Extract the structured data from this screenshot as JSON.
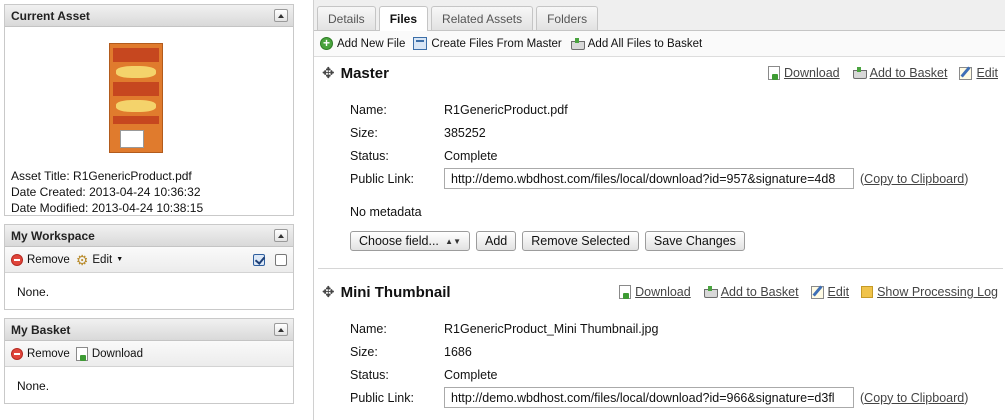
{
  "current_asset": {
    "title": "Current Asset",
    "asset_title_label": "Asset Title:",
    "asset_title": "R1GenericProduct.pdf",
    "date_created_label": "Date Created:",
    "date_created": "2013-04-24 10:36:32",
    "date_modified_label": "Date Modified:",
    "date_modified": "2013-04-24 10:38:15"
  },
  "workspace": {
    "title": "My Workspace",
    "remove_label": "Remove",
    "edit_label": "Edit",
    "empty_text": "None.",
    "select_all_checked": true,
    "select_none_checked": false
  },
  "basket": {
    "title": "My Basket",
    "remove_label": "Remove",
    "download_label": "Download",
    "empty_text": "None."
  },
  "tabs": [
    {
      "label": "Details"
    },
    {
      "label": "Files"
    },
    {
      "label": "Related Assets"
    },
    {
      "label": "Folders"
    }
  ],
  "active_tab": "Files",
  "files_toolbar": {
    "add_new_file": "Add New File",
    "create_from_master": "Create Files From Master",
    "add_all_to_basket": "Add All Files to Basket"
  },
  "master": {
    "title": "Master",
    "download": "Download",
    "add_to_basket": "Add to Basket",
    "edit": "Edit",
    "name_label": "Name:",
    "name": "R1GenericProduct.pdf",
    "size_label": "Size:",
    "size": "385252",
    "status_label": "Status:",
    "status": "Complete",
    "public_link_label": "Public Link:",
    "public_link": "http://demo.wbdhost.com/files/local/download?id=957&signature=4d8",
    "copy_prefix": "(",
    "copy_label": "Copy to Clipboard",
    "copy_suffix": ")",
    "no_metadata": "No metadata",
    "choose_field": "Choose field...",
    "add_btn": "Add",
    "remove_selected_btn": "Remove Selected",
    "save_changes_btn": "Save Changes"
  },
  "mini_thumbnail": {
    "title": "Mini Thumbnail",
    "download": "Download",
    "add_to_basket": "Add to Basket",
    "edit": "Edit",
    "show_log": "Show Processing Log",
    "name_label": "Name:",
    "name": "R1GenericProduct_Mini Thumbnail.jpg",
    "size_label": "Size:",
    "size": "1686",
    "status_label": "Status:",
    "status": "Complete",
    "public_link_label": "Public Link:",
    "public_link": "http://demo.wbdhost.com/files/local/download?id=966&signature=d3fl",
    "copy_prefix": "(",
    "copy_label": "Copy to Clipboard",
    "copy_suffix": ")"
  },
  "colors": {
    "accent_green": "#49a33d",
    "remove_red": "#e0453b",
    "thumbnail_orange": "#e07b2d"
  }
}
